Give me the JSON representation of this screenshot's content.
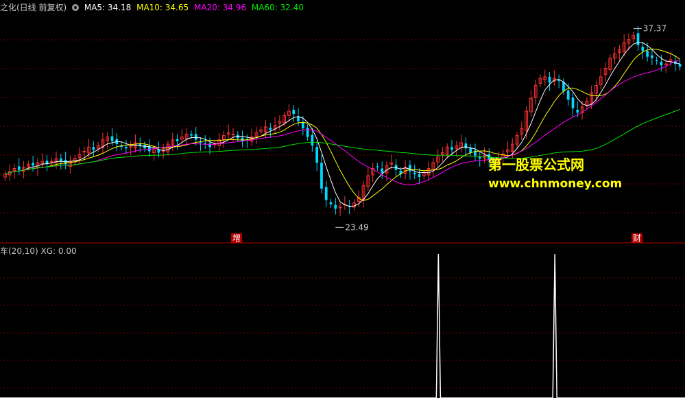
{
  "header": {
    "title": "之化(日线 前复权)",
    "ma5": "MA5: 34.18",
    "ma10": "MA10: 34.65",
    "ma20": "MA20: 34.96",
    "ma60": "MA60: 32.40"
  },
  "indicator": {
    "title": "车(20,10) XG: 0.00"
  },
  "watermark": {
    "line1": "第一股票公式网",
    "line2": "www.chnmoney.com"
  },
  "markers": {
    "left": "增",
    "right": "财"
  },
  "colors": {
    "up": "#ff3232",
    "down": "#00d8ff",
    "ma5": "#ffffff",
    "ma10": "#ffff00",
    "ma20": "#ff00ff",
    "ma60": "#00e600",
    "grid": "#7a0000",
    "xg": "#ffffff"
  },
  "chart_data": {
    "type": "candlestick",
    "price_range": [
      22.5,
      38.5
    ],
    "high_label": "37.37",
    "low_label": "23.49",
    "series": [
      {
        "name": "MA5",
        "value": 34.18
      },
      {
        "name": "MA10",
        "value": 34.65
      },
      {
        "name": "MA20",
        "value": 34.96
      },
      {
        "name": "MA60",
        "value": 32.4
      }
    ],
    "close": [
      27.2,
      27.4,
      27.6,
      27.5,
      27.7,
      27.9,
      27.8,
      28.0,
      28.1,
      27.9,
      28.1,
      28.3,
      28.1,
      27.9,
      28.1,
      28.3,
      28.6,
      28.8,
      29.1,
      28.9,
      29.2,
      29.6,
      29.8,
      29.5,
      29.3,
      29.1,
      29.0,
      29.2,
      29.4,
      29.2,
      29.0,
      28.8,
      28.9,
      28.7,
      28.9,
      29.3,
      29.6,
      29.5,
      29.8,
      30.0,
      29.9,
      29.6,
      29.4,
      29.3,
      29.1,
      29.3,
      29.6,
      29.9,
      30.1,
      30.0,
      29.7,
      29.5,
      29.6,
      29.8,
      30.1,
      30.3,
      30.5,
      30.3,
      30.6,
      30.9,
      31.3,
      31.6,
      31.4,
      30.9,
      30.4,
      29.8,
      29.2,
      28.0,
      26.2,
      25.4,
      25.1,
      24.8,
      24.9,
      25.1,
      24.9,
      25.2,
      25.6,
      26.4,
      27.1,
      27.6,
      27.7,
      27.3,
      27.8,
      28.0,
      27.5,
      27.2,
      27.7,
      27.4,
      27.2,
      27.0,
      27.3,
      27.6,
      28.0,
      28.4,
      28.7,
      29.1,
      28.9,
      29.2,
      29.4,
      29.0,
      28.7,
      28.5,
      28.3,
      28.5,
      28.2,
      28.0,
      28.3,
      28.6,
      28.9,
      29.3,
      29.9,
      30.4,
      31.6,
      32.5,
      33.4,
      33.9,
      34.0,
      33.6,
      33.9,
      33.7,
      33.0,
      32.4,
      31.8,
      31.5,
      31.9,
      32.3,
      32.9,
      33.4,
      34.0,
      34.6,
      35.3,
      35.6,
      35.9,
      36.4,
      36.6,
      36.9,
      36.2,
      35.8,
      35.4,
      35.3,
      35.1,
      34.8,
      34.9,
      35.2,
      34.9,
      34.7
    ],
    "xg_spikes": [
      0.64,
      0.81
    ]
  }
}
